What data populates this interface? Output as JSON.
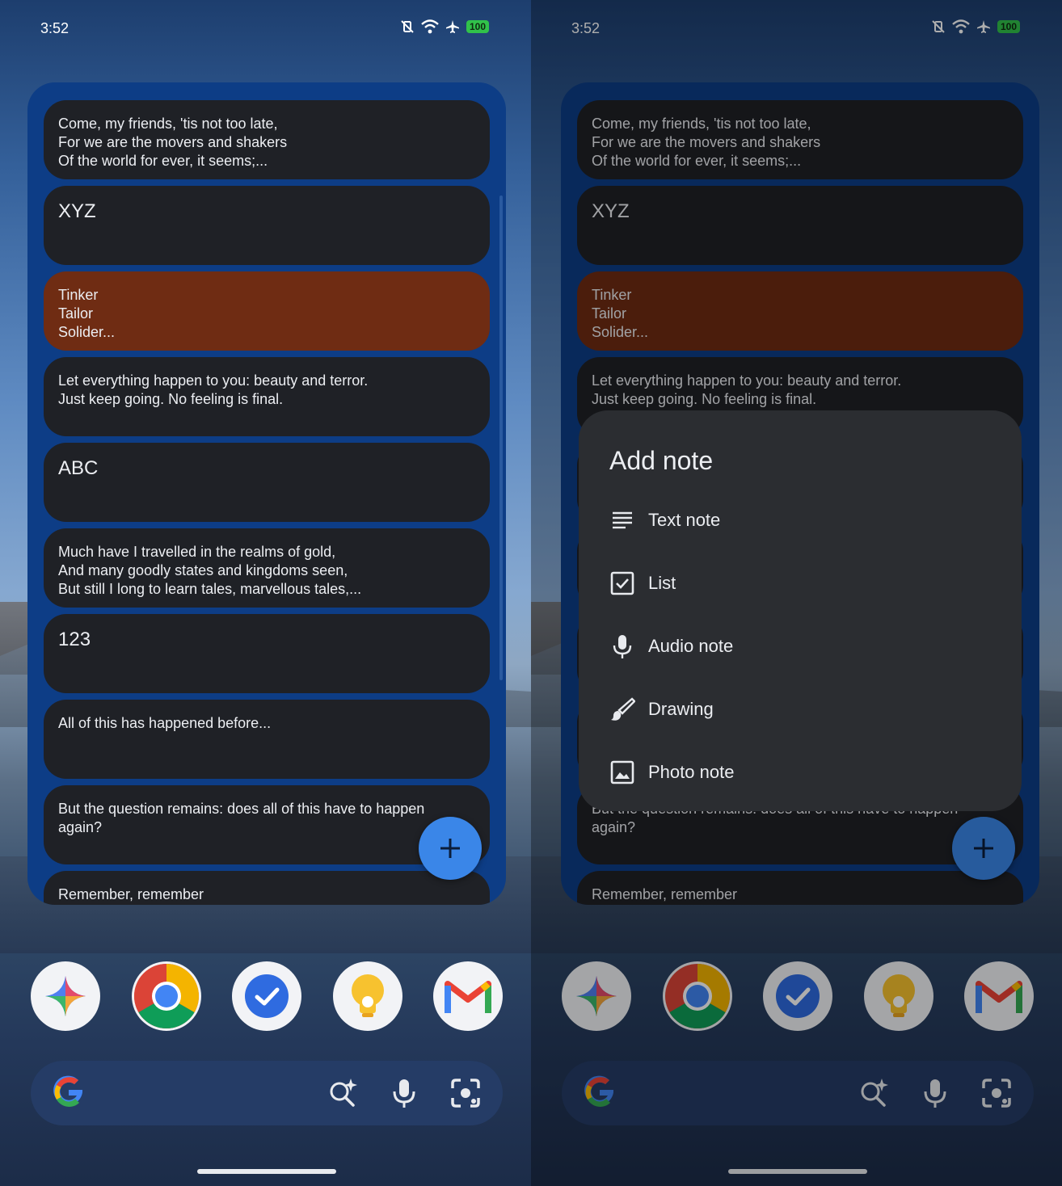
{
  "status": {
    "time": "3:52",
    "battery": "100"
  },
  "notes": [
    {
      "text": "Come, my friends, 'tis not too late,\nFor we are the movers and shakers\nOf the world for ever, it seems;..."
    },
    {
      "text": "XYZ"
    },
    {
      "text": "Tinker\nTailor\nSolider..."
    },
    {
      "text": "Let everything happen to you: beauty and terror.\nJust keep going. No feeling is final."
    },
    {
      "text": "ABC"
    },
    {
      "text": "Much have I travelled in the realms of gold,\nAnd many goodly states and kingdoms seen,\nBut still I long to learn tales, marvellous tales,..."
    },
    {
      "text": "123"
    },
    {
      "text": "All of this has happened before..."
    },
    {
      "text": "But the question remains: does all of this have to happen\nagain?"
    },
    {
      "text": "Remember, remember"
    }
  ],
  "add_note_menu": {
    "title": "Add note",
    "items": [
      {
        "label": "Text note",
        "icon": "text-note-icon"
      },
      {
        "label": "List",
        "icon": "checkbox-icon"
      },
      {
        "label": "Audio note",
        "icon": "microphone-icon"
      },
      {
        "label": "Drawing",
        "icon": "brush-icon"
      },
      {
        "label": "Photo note",
        "icon": "image-icon"
      }
    ]
  },
  "dock_apps": [
    "gemini-icon",
    "chrome-icon",
    "tasks-icon",
    "keep-icon",
    "gmail-icon"
  ],
  "colors": {
    "widget_bg": "#0d3d86",
    "note_bg": "#1f2126",
    "note_orange": "#6f2c13",
    "fab": "#3a86e8"
  }
}
